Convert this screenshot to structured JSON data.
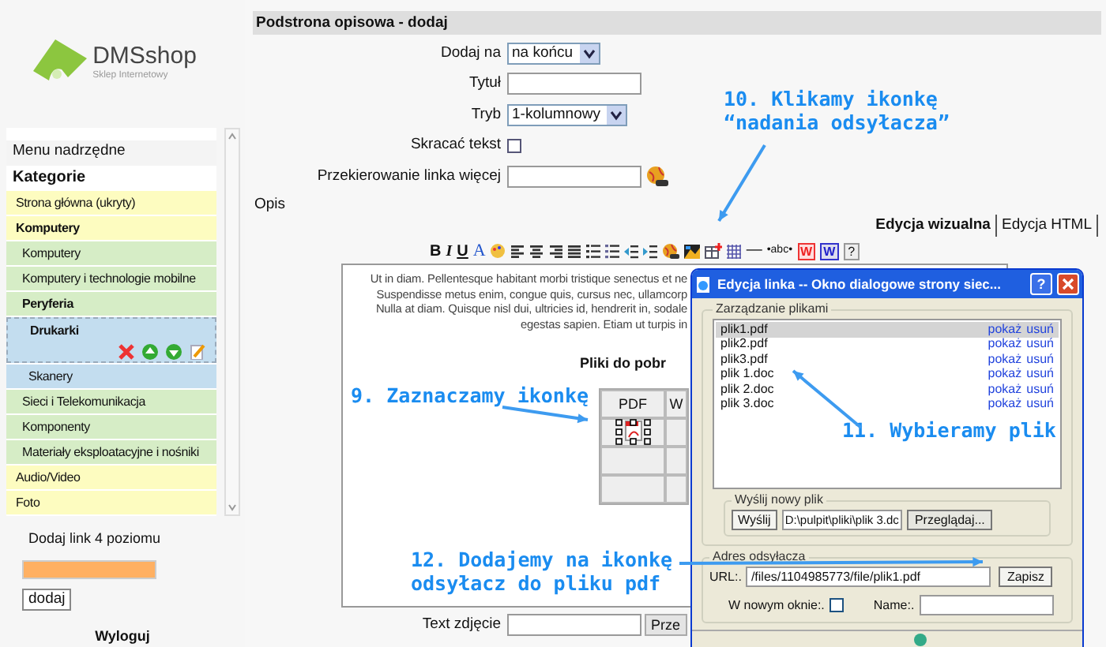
{
  "sidebar": {
    "logo": {
      "name": "DMSshop",
      "tagline": "Sklep Internetowy"
    },
    "menu_title": "Menu nadrzędne",
    "section": "Kategorie",
    "categories": [
      {
        "label": "Strona główna",
        "note": "(ukryty)",
        "selected": false
      },
      {
        "label": "Komputery",
        "selected": false,
        "children": [
          {
            "label": "Komputery",
            "selected": false
          },
          {
            "label": "Komputery i technologie mobilne",
            "selected": false
          },
          {
            "label": "Peryferia",
            "selected": false,
            "children": [
              {
                "label": "Drukarki",
                "selected": true
              },
              {
                "label": "Skanery",
                "selected": false
              }
            ]
          },
          {
            "label": "Sieci i Telekomunikacja",
            "selected": false
          },
          {
            "label": "Komponenty",
            "selected": false
          },
          {
            "label": "Materiały eksploatacyjne i nośniki",
            "selected": false
          }
        ]
      },
      {
        "label": "Audio/Video",
        "selected": false
      },
      {
        "label": "Foto",
        "selected": false
      }
    ],
    "add_label": "Dodaj link 4 poziomu",
    "add_button": "dodaj",
    "logout": "Wyloguj"
  },
  "page": {
    "title": "Podstrona opisowa - dodaj",
    "fields": [
      {
        "label": "Dodaj na",
        "kind": "select",
        "value": "na końcu"
      },
      {
        "label": "Tytuł",
        "kind": "text"
      },
      {
        "label": "Tryb",
        "kind": "select",
        "value": "1-kolumnowy"
      },
      {
        "label": "Skracać tekst",
        "kind": "checkbox",
        "checked": false
      },
      {
        "label": "Przekierowanie linka więcej",
        "kind": "link"
      }
    ],
    "editor": {
      "label": "Opis",
      "tabs": [
        {
          "label": "Edycja wizualna",
          "selected": true
        },
        {
          "label": "Edycja HTML",
          "selected": false
        }
      ],
      "toolbar": [
        {
          "kind": "bold",
          "label": "B"
        },
        {
          "kind": "italic",
          "label": "I"
        },
        {
          "kind": "underline",
          "label": "U"
        },
        {
          "kind": "text-color",
          "label": "A"
        },
        {
          "kind": "palette"
        },
        {
          "kind": "align-left"
        },
        {
          "kind": "align-center"
        },
        {
          "kind": "align-right"
        },
        {
          "kind": "justify"
        },
        {
          "kind": "bullets"
        },
        {
          "kind": "numbers"
        },
        {
          "kind": "outdent"
        },
        {
          "kind": "indent"
        },
        {
          "kind": "link"
        },
        {
          "kind": "image"
        },
        {
          "kind": "table"
        },
        {
          "kind": "grid"
        },
        {
          "kind": "rule",
          "label": "—"
        },
        {
          "kind": "anchor",
          "label": "•abc•"
        },
        {
          "kind": "word-red",
          "label": "W"
        },
        {
          "kind": "word-blue",
          "label": "W"
        },
        {
          "kind": "help",
          "label": "?"
        }
      ],
      "paragraph": "Ut in diam. Pellentesque habitant morbi tristique senectus et ne\nSuspendisse metus enim, congue quis, cursus nec, ullamcorp\nNulla at diam. Quisque nisl dui, ultricies id, hendrerit in, sodale\negestas sapien. Etiam ut turpis in",
      "heading": "Pliki do pobr",
      "table": {
        "columns": [
          "PDF",
          "W"
        ],
        "rows": [
          {
            "kind": "pdf"
          },
          {
            "kind": "empty"
          },
          {
            "kind": "empty"
          }
        ]
      }
    },
    "caption_field": {
      "label": "Text zdjęcie",
      "button": "Prze"
    }
  },
  "dialog": {
    "title": "Edycja linka -- Okno dialogowe strony siec...",
    "help": "?",
    "files_group": "Zarządzanie plikami",
    "files": [
      {
        "name": "plik1.pdf",
        "show": "pokaż",
        "delete": "usuń",
        "selected": true
      },
      {
        "name": "plik2.pdf",
        "show": "pokaż",
        "delete": "usuń",
        "selected": false
      },
      {
        "name": "plik3.pdf",
        "show": "pokaż",
        "delete": "usuń",
        "selected": false
      },
      {
        "name": "plik 1.doc",
        "show": "pokaż",
        "delete": "usuń",
        "selected": false
      },
      {
        "name": "plik 2.doc",
        "show": "pokaż",
        "delete": "usuń",
        "selected": false
      },
      {
        "name": "plik 3.doc",
        "show": "pokaż",
        "delete": "usuń",
        "selected": false
      }
    ],
    "upload_group": "Wyślij nowy plik",
    "upload_button": "Wyślij",
    "upload_path": "D:\\pulpit\\pliki\\plik 3.dc",
    "browse_button": "Przeglądaj...",
    "address_group": "Adres odsyłacza",
    "url_label": "URL:.",
    "url": "/files/1104985773/file/plik1.pdf",
    "save_button": "Zapisz",
    "new_window_label": "W nowym oknie:.",
    "new_window": false,
    "name_label": "Name:."
  },
  "annotations": [
    {
      "text": "9. Zaznaczamy ikonkę"
    },
    {
      "text": "10. Klikamy ikonkę\n“nadania odsyłacza”"
    },
    {
      "text": "11. Wybieramy plik"
    },
    {
      "text": "12. Dodajemy na ikonkę\nodsyłacz do pliku pdf"
    }
  ]
}
